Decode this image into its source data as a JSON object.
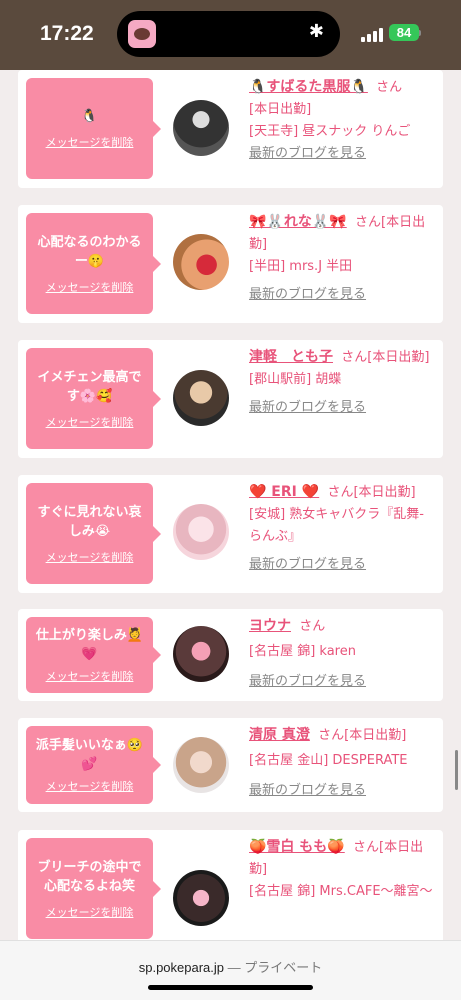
{
  "status": {
    "time": "17:22",
    "battery": "84",
    "bt_icon": "bluetooth-icon"
  },
  "messages": [
    {
      "message": "🐧",
      "delete_label": "メッセージを削除",
      "name": "🐧すばるた黒服🐧",
      "san": "さん",
      "lines": [
        "[本日出勤]",
        "[天王寺] 昼スナック りんご"
      ],
      "blog": "最新のブログを見る"
    },
    {
      "message": "心配なるのわかるー🤫",
      "delete_label": "メッセージを削除",
      "name": "🎀🐰れな🐰🎀",
      "san": "さん[本日出勤]",
      "lines": [
        "[半田] mrs.J 半田"
      ],
      "blog": "最新のブログを見る"
    },
    {
      "message": "イメチェン最高です🌸🥰",
      "delete_label": "メッセージを削除",
      "name": "津軽　とも子",
      "san": "さん[本日出勤]",
      "lines": [
        "[郡山駅前] 胡蝶"
      ],
      "blog": "最新のブログを見る"
    },
    {
      "message": "すぐに見れない哀しみ😭",
      "delete_label": "メッセージを削除",
      "name": "❤️ ERI ❤️",
      "san": "さん[本日出勤]",
      "lines": [
        "[安城] 熟女キャバクラ『乱舞-らんぶ』"
      ],
      "blog": "最新のブログを見る"
    },
    {
      "message": "仕上がり楽しみ💆💗",
      "delete_label": "メッセージを削除",
      "name": "ヨウナ",
      "san": "さん",
      "lines": [
        "[名古屋 錦] karen"
      ],
      "blog": "最新のブログを見る"
    },
    {
      "message": "派手髪いいなぁ🥺💕",
      "delete_label": "メッセージを削除",
      "name": "清原 真澄",
      "san": "さん[本日出勤]",
      "lines": [
        "[名古屋 金山] DESPERATE"
      ],
      "blog": "最新のブログを見る"
    },
    {
      "message": "ブリーチの途中で心配なるよね笑",
      "delete_label": "メッセージを削除",
      "name": "🍑雪白 もも🍑",
      "san": "さん[本日出勤]",
      "lines": [
        "[名古屋 錦] Mrs.CAFE〜離宮〜"
      ],
      "blog": ""
    }
  ],
  "browser": {
    "url": "sp.pokepara.jp",
    "mode": "— プライベート"
  }
}
